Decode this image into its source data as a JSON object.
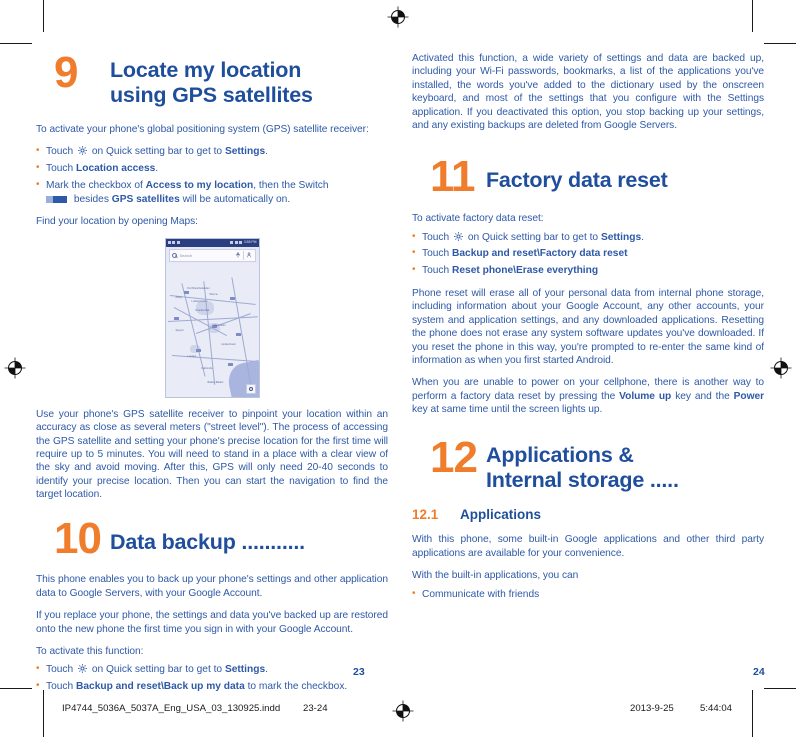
{
  "document": {
    "left_page_number": "23",
    "right_page_number": "24",
    "colors": {
      "heading_blue": "#1F4E9C",
      "body_blue": "#2E59A7",
      "accent_orange": "#F07D2B"
    }
  },
  "footer": {
    "filename": "IP4744_5036A_5037A_Eng_USA_03_130925.indd",
    "page_range": "23-24",
    "date": "2013-9-25",
    "time": "5:44:04"
  },
  "left_column": {
    "chapter": {
      "number": "9",
      "title_line1": "Locate my location",
      "title_line2_plain_a": "using ",
      "title_line2_bold": "GPS",
      "title_line2_plain_b": " satellites"
    },
    "intro": "To activate your phone's global positioning system (GPS) satellite receiver:",
    "bullets": [
      {
        "id": "touch-settings",
        "prefix": "Touch ",
        "icon": "gear-icon",
        "middle": " on Quick setting bar to get to ",
        "bold": "Settings",
        "suffix": "."
      },
      {
        "id": "touch-location-access",
        "prefix": "Touch ",
        "bold": "Location access",
        "suffix": "."
      },
      {
        "id": "mark-checkbox",
        "prefix": "Mark the checkbox of ",
        "bold": "Access to my location",
        "middle": ", then the Switch ",
        "icon": "switch-icon",
        "bold2": "GPS satellites",
        "middle2": " besides ",
        "suffix": " will be automatically on."
      }
    ],
    "find_location": "Find your location by opening Maps:",
    "map_screenshot": {
      "name": "maps-app-screenshot",
      "status_time": "3:58 PM",
      "search_placeholder": "Search",
      "search_icon": "search-icon",
      "directions_icon": "directions-icon",
      "profile_icon": "person-icon",
      "my_location_icon": "my-location-icon",
      "place_labels": [
        "Kirchheimbolanden",
        "Alzey",
        "Worms",
        "Frankenthal",
        "Ludwigshafen",
        "Mannheim",
        "Speyer",
        "Neustadt",
        "Landau",
        "Bad Dürkheim",
        "Heidelberg",
        "Hockenheim",
        "Schwetzingen",
        "Wiesloch",
        "Sinsheim",
        "Bruchsal",
        "Karlsruhe",
        "Rastatt",
        "Baden-Baden",
        "Pforzheim"
      ]
    },
    "gps_paragraph": "Use your phone's GPS satellite receiver to pinpoint your location within an accuracy as close as several meters (\"street level\"). The process of accessing the GPS satellite and setting your phone's precise location for the first time will require up to 5 minutes. You will need to stand in a place with a clear view of the sky and avoid moving. After this, GPS will only need 20-40 seconds to identify your precise location. Then you can start the navigation to find the target location.",
    "chapter10": {
      "number": "10",
      "title": "Data backup ..........."
    },
    "backup_para1": "This phone enables you to back up your phone's settings and other application data to Google Servers, with your Google Account.",
    "backup_para2": "If you replace your phone, the settings and data you've backed up are restored onto the new phone the first time you sign in with your Google Account.",
    "backup_activate": "To activate this function:",
    "backup_bullets": [
      {
        "id": "touch-settings-2",
        "prefix": "Touch ",
        "icon": "gear-icon",
        "middle": " on Quick setting bar to get to ",
        "bold": "Settings",
        "suffix": "."
      },
      {
        "id": "touch-backup-and-reset",
        "prefix": "Touch ",
        "bold": "Backup and reset\\Back up my data",
        "suffix": " to mark the checkbox."
      }
    ]
  },
  "right_column": {
    "activated_para": "Activated this function, a wide variety of settings and data are backed up, including your Wi-Fi passwords, bookmarks, a list of the applications you've installed, the words you've added to the dictionary used by the onscreen keyboard, and most of the settings that you configure with the Settings application. If you deactivated this option, you stop backing up your settings, and any existing backups are deleted from Google Servers.",
    "chapter11": {
      "number": "11",
      "title": "Factory data reset"
    },
    "factory_intro": "To activate factory data reset:",
    "factory_bullets": [
      {
        "id": "touch-settings-3",
        "prefix": "Touch ",
        "icon": "gear-icon",
        "middle": " on Quick setting bar to get to ",
        "bold": "Settings",
        "suffix": "."
      },
      {
        "id": "touch-factory-data-reset",
        "prefix": "Touch ",
        "bold": "Backup and reset\\Factory data reset",
        "suffix": ""
      },
      {
        "id": "touch-reset-phone",
        "prefix": "Touch ",
        "bold": "Reset phone\\Erase everything",
        "suffix": ""
      }
    ],
    "reset_para1": "Phone reset will erase all of your personal data from internal phone storage, including information about your Google Account, any other accounts, your system and application settings, and any downloaded applications. Resetting the phone does not erase any system software updates you've downloaded. If you reset the phone in this way, you're prompted to re-enter the same kind of information as when you first started Android.",
    "reset_para2_a": "When you are unable to power on your cellphone, there is another way to perform a factory data reset by pressing the ",
    "reset_para2_bold1": "Volume up",
    "reset_para2_b": " key and the ",
    "reset_para2_bold2": "Power",
    "reset_para2_c": " key at same time until the screen lights up.",
    "chapter12": {
      "number": "12",
      "title_line1": "Applications &",
      "title_line2": "Internal storage ....."
    },
    "subsection": {
      "number": "12.1",
      "title": "Applications"
    },
    "apps_para1": "With this phone, some built-in Google applications and other third party applications are available for your convenience.",
    "apps_para2": "With the built-in applications, you can",
    "apps_bullets": [
      {
        "id": "communicate-with-friends",
        "text": "Communicate with friends"
      }
    ]
  }
}
